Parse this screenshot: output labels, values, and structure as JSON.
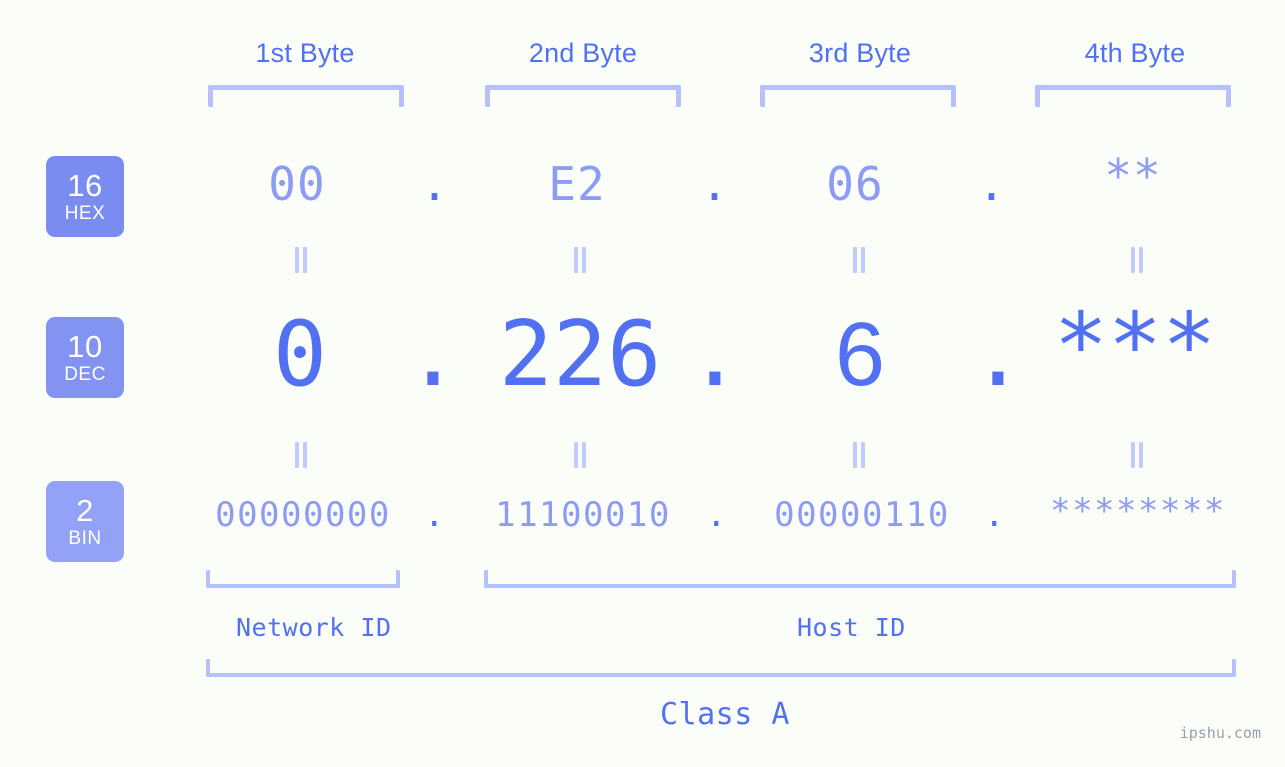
{
  "background_color": "#fbfdf8",
  "accent_color": "#5271f2",
  "accent_light_color": "#8c9bf3",
  "bracket_color": "#b6c0fb",
  "byte_headers": [
    {
      "label": "1st Byte"
    },
    {
      "label": "2nd Byte"
    },
    {
      "label": "3rd Byte"
    },
    {
      "label": "4th Byte"
    }
  ],
  "bases": [
    {
      "num": "16",
      "name": "HEX",
      "color": "#7b8cf0"
    },
    {
      "num": "10",
      "name": "DEC",
      "color": "#8393f1"
    },
    {
      "num": "2",
      "name": "BIN",
      "color": "#93a2f6"
    }
  ],
  "separator": ".",
  "equals_glyph": "=",
  "rows": {
    "hex": {
      "base_label": "HEX",
      "values": [
        "00",
        "E2",
        "06",
        "**"
      ]
    },
    "dec": {
      "base_label": "DEC",
      "values": [
        "0",
        "226",
        "6",
        "***"
      ]
    },
    "bin": {
      "base_label": "BIN",
      "values": [
        "00000000",
        "11100010",
        "00000110",
        "********"
      ]
    }
  },
  "sections": {
    "network_id": "Network ID",
    "host_id": "Host ID",
    "class": "Class A"
  },
  "watermark": "ipshu.com"
}
